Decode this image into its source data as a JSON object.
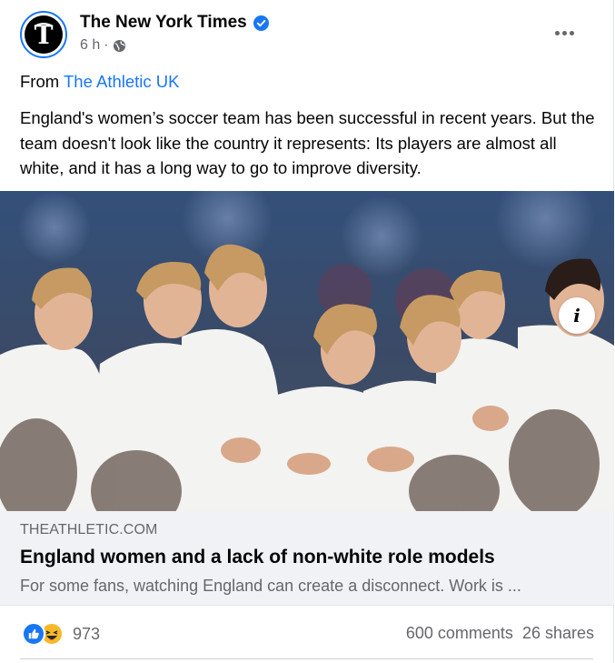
{
  "post": {
    "page_name": "The New York Times",
    "time": "6 h",
    "meta_separator": "·",
    "from_prefix": "From",
    "from_source": "The Athletic UK",
    "text": "England's women’s soccer team has been successful in recent years. But the team doesn't look like the country it represents: Its players are almost all white, and it has a long way to go to improve diversity."
  },
  "icons": {
    "verified": "verified-badge-icon",
    "audience": "globe-icon",
    "more": "more-options-icon",
    "info": "info-icon",
    "like": "like-reaction-icon",
    "haha": "haha-reaction-icon"
  },
  "link_preview": {
    "domain": "THEATHLETIC.COM",
    "title": "England women and a lack of non-white role models",
    "description": "For some fans, watching England can create a disconnect. Work is ..."
  },
  "info_button": {
    "glyph": "i"
  },
  "footer": {
    "reaction_count": "973",
    "comments": "600 comments",
    "shares": "26 shares"
  },
  "colors": {
    "link_blue": "#1877f2",
    "secondary_text": "#65676b",
    "preview_bg": "#f0f2f5",
    "haha_yellow": "#f7b928"
  }
}
